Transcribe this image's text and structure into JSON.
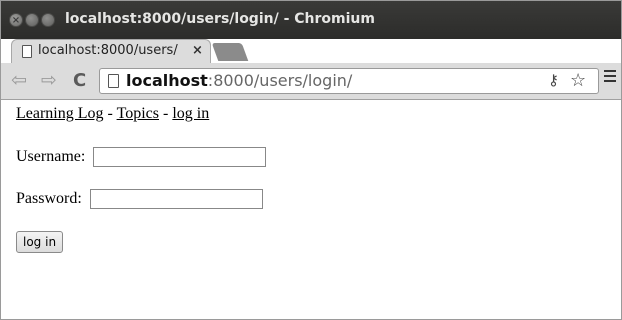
{
  "window": {
    "title": "localhost:8000/users/login/ - Chromium"
  },
  "tab": {
    "label": "localhost:8000/users/",
    "close": "×"
  },
  "toolbar": {
    "back_icon": "back-arrow-icon",
    "forward_icon": "forward-arrow-icon",
    "reload_icon": "reload-icon",
    "address": {
      "host": "localhost",
      "rest": ":8000/users/login/"
    }
  },
  "page": {
    "nav": {
      "home": "Learning Log",
      "sep1": " - ",
      "topics": "Topics",
      "sep2": " - ",
      "login": "log in"
    },
    "form": {
      "username_label": "Username:",
      "username_value": "",
      "password_label": "Password:",
      "password_value": "",
      "submit_label": "log in"
    }
  },
  "colors": {
    "titlebar": "#2f2f2d",
    "toolbar": "#dcdcdc",
    "page_bg": "#ffffff"
  }
}
